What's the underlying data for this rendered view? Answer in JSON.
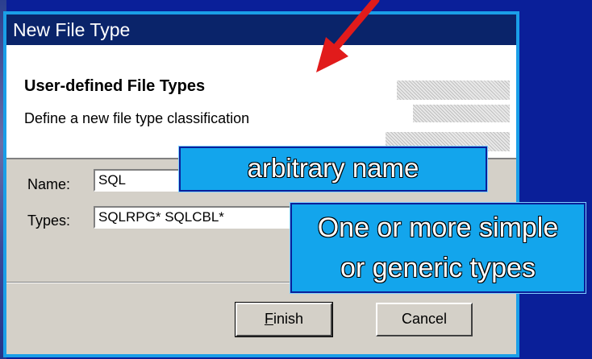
{
  "dialog": {
    "title": "New File Type",
    "banner_title": "User-defined File Types",
    "banner_description": "Define a new file type classification",
    "name_label": "Name:",
    "name_value": "SQL",
    "types_label": "Types:",
    "types_value": "SQLRPG* SQLCBL*",
    "finish_label": "Finish",
    "finish_mnemonic": "F",
    "finish_rest": "inish",
    "cancel_label": "Cancel"
  },
  "callouts": {
    "name_note": "arbitrary name",
    "types_note_line1": "One or more simple",
    "types_note_line2": "or generic types"
  },
  "colors": {
    "background": "#0a1f99",
    "title_bar": "#0a246a",
    "callout": "#13a5ec",
    "arrow": "#e11b1b",
    "dialog_border": "#1a9fe8"
  },
  "icons": {
    "arrow": "red-pointer-arrow"
  }
}
